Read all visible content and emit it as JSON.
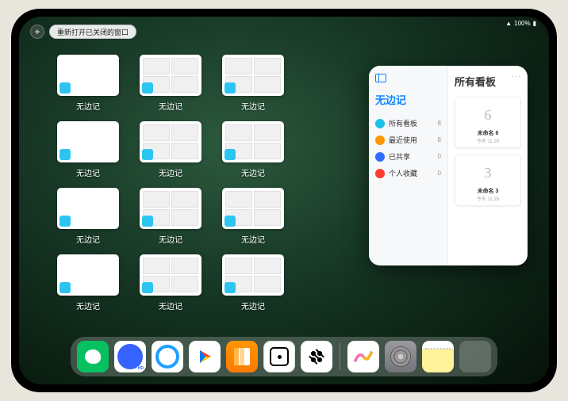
{
  "status": {
    "signal": "􀙇",
    "battery": "100%"
  },
  "topbar": {
    "add": "+",
    "reopen": "重新打开已关闭的窗口"
  },
  "windows": [
    {
      "label": "无边记",
      "type": "white"
    },
    {
      "label": "无边记",
      "type": "grid"
    },
    {
      "label": "无边记",
      "type": "grid"
    },
    {
      "label": "无边记",
      "type": "white"
    },
    {
      "label": "无边记",
      "type": "grid"
    },
    {
      "label": "无边记",
      "type": "grid"
    },
    {
      "label": "无边记",
      "type": "white"
    },
    {
      "label": "无边记",
      "type": "grid"
    },
    {
      "label": "无边记",
      "type": "grid"
    },
    {
      "label": "无边记",
      "type": "white"
    },
    {
      "label": "无边记",
      "type": "grid"
    },
    {
      "label": "无边记",
      "type": "grid"
    }
  ],
  "slideover": {
    "more": "···",
    "left_title": "无边记",
    "right_title": "所有看板",
    "items": [
      {
        "icon": "#1cc1e8",
        "label": "所有看板",
        "count": "8"
      },
      {
        "icon": "#ff9500",
        "label": "最近使用",
        "count": "8"
      },
      {
        "icon": "#2f6dff",
        "label": "已共享",
        "count": "0"
      },
      {
        "icon": "#ff3b30",
        "label": "个人收藏",
        "count": "0"
      }
    ],
    "boards": [
      {
        "sketch": "6",
        "name": "未命名 6",
        "time": "今天 11:29"
      },
      {
        "sketch": "3",
        "name": "未命名 3",
        "time": "今天 11:28"
      }
    ]
  },
  "dock": {
    "apps": [
      "wechat",
      "quark-hd",
      "quark",
      "play",
      "books",
      "dot",
      "meitu",
      "freeform",
      "settings",
      "notes"
    ],
    "recents_folder": true
  }
}
